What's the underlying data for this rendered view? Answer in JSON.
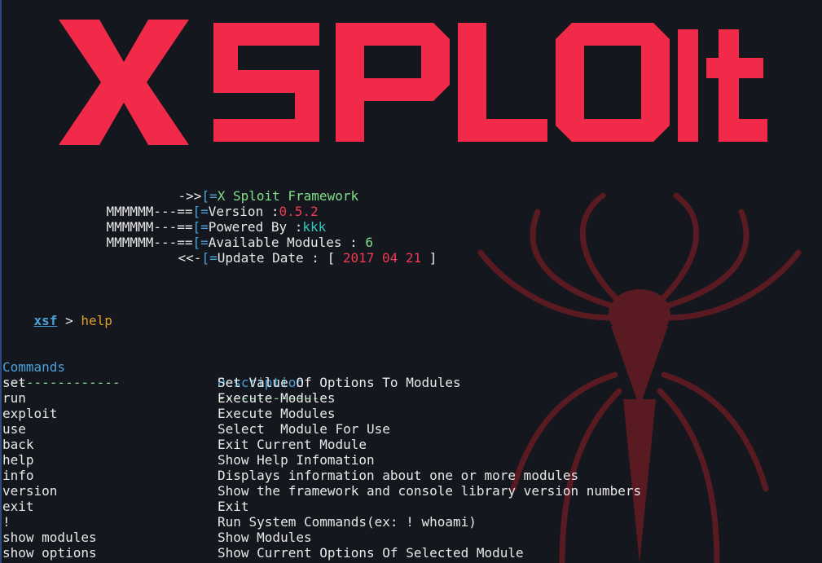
{
  "banner": {
    "logo_text": "XSPLOIT",
    "color": "#f02a48"
  },
  "info": {
    "line1": {
      "prefix": "->>",
      "bracket": "[=",
      "text": "X Sploit Framework"
    },
    "line2": {
      "prefix": "MMMMMM---==",
      "bracket": "[=",
      "label": "Version :",
      "value": "0.5.2"
    },
    "line3": {
      "prefix": "MMMMMM---==",
      "bracket": "[=",
      "label": "Powered By :",
      "value": "kkk"
    },
    "line4": {
      "prefix": "MMMMMM---==",
      "bracket": "[=",
      "label": "Available Modules : ",
      "value": "6"
    },
    "line5": {
      "prefix": "<<-",
      "bracket": "[=",
      "label": "Update Date : [ ",
      "value": "2017 04 21",
      "suffix": " ]"
    }
  },
  "prompt": {
    "name": "xsf",
    "separator": " > ",
    "command": "help"
  },
  "help_table": {
    "headers": {
      "commands": "Commands",
      "description": "Description"
    },
    "underline_cmd": "---------------",
    "underline_desc": "--------------",
    "rows": [
      {
        "cmd": "set",
        "desc": "Set Value Of Options To Modules"
      },
      {
        "cmd": "run",
        "desc": "Execute Modules"
      },
      {
        "cmd": "exploit",
        "desc": "Execute Modules"
      },
      {
        "cmd": "use",
        "desc": "Select  Module For Use"
      },
      {
        "cmd": "back",
        "desc": "Exit Current Module"
      },
      {
        "cmd": "help",
        "desc": "Show Help Infomation"
      },
      {
        "cmd": "info",
        "desc": "Displays information about one or more modules"
      },
      {
        "cmd": "version",
        "desc": "Show the framework and console library version numbers"
      },
      {
        "cmd": "exit",
        "desc": "Exit"
      },
      {
        "cmd": "!",
        "desc": "Run System Commands(ex: ! whoami)"
      },
      {
        "cmd": "show modules",
        "desc": "Show Modules"
      },
      {
        "cmd": "show options",
        "desc": "Show Current Options Of Selected Module"
      }
    ]
  },
  "colors": {
    "background": "#14171d",
    "accent_blue": "#4aa3d8",
    "accent_red": "#f03a52",
    "accent_green": "#7fe08a",
    "accent_cyan": "#2ec8c0",
    "accent_orange": "#e0a030",
    "spider": "#5a1a22"
  },
  "icons": {
    "watermark": "spider-icon"
  }
}
